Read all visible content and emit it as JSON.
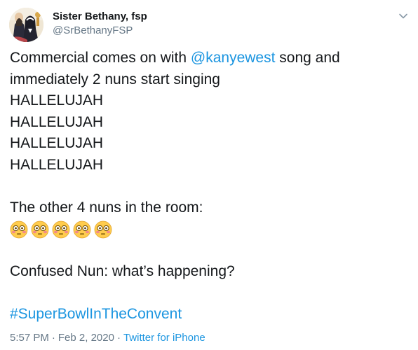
{
  "author": {
    "display_name": "Sister Bethany, fsp",
    "handle": "@SrBethanyFSP",
    "avatar_icon": "nun-portrait-avatar"
  },
  "menu": {
    "icon": "chevron-down-icon"
  },
  "tweet": {
    "line1_prefix": "Commercial comes on with ",
    "line1_mention": "@kanyewest",
    "line1_suffix": " song and",
    "line2": "immediately 2 nuns start singing",
    "hallelujah": [
      "HALLELUJAH",
      "HALLELUJAH",
      "HALLELUJAH",
      "HALLELUJAH"
    ],
    "line_other": "The other 4 nuns in the room:",
    "emojis": [
      "flushed-face-emoji",
      "flushed-face-emoji",
      "flushed-face-emoji",
      "flushed-face-emoji",
      "flushed-face-emoji"
    ],
    "line_confused": "Confused Nun: what’s happening?",
    "hashtag": "#SuperBowlInTheConvent"
  },
  "meta": {
    "time": "5:57 PM",
    "separator": "·",
    "date": "Feb 2, 2020",
    "source": "Twitter for iPhone"
  },
  "colors": {
    "link": "#1b95e0",
    "text": "#14171a",
    "muted": "#657786"
  }
}
